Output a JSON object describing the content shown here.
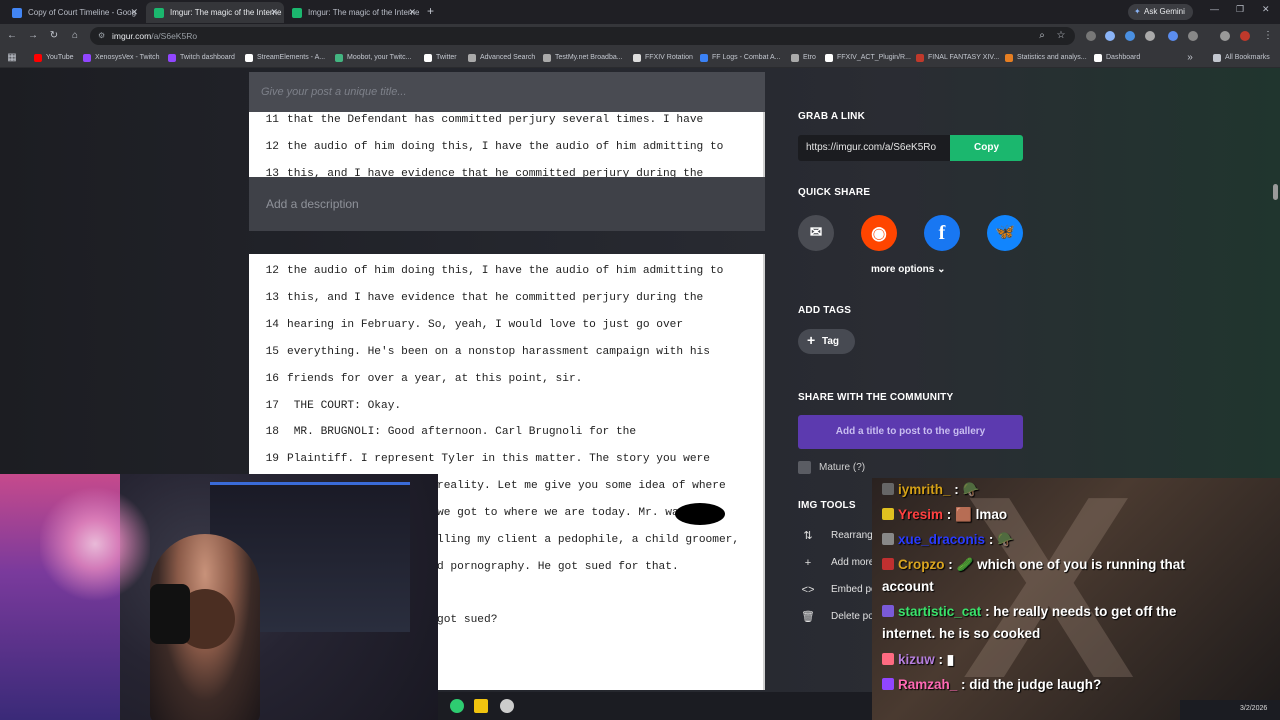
{
  "browser": {
    "tabs": [
      {
        "label": "Copy of Court Timeline - Goog",
        "color": "#4285f4"
      },
      {
        "label": "Imgur: The magic of the Interne",
        "color": "#1bb76e"
      },
      {
        "label": "Imgur: The magic of the Interne",
        "color": "#1bb76e"
      }
    ],
    "tab_close": "✕",
    "new_tab": "+",
    "gemini_label": "Ask Gemini",
    "url_host": "imgur.com",
    "url_path": "/a/S6eK5Ro",
    "bookmarks": [
      {
        "label": "YouTube",
        "color": "#ff0000"
      },
      {
        "label": "XenosysVex - Twitch",
        "color": "#9146ff"
      },
      {
        "label": "Twitch dashboard",
        "color": "#9146ff"
      },
      {
        "label": "StreamElements - A...",
        "color": "#ffffff"
      },
      {
        "label": "Moobot, your Twitc...",
        "color": "#43b581"
      },
      {
        "label": "Twitter",
        "color": "#ffffff"
      },
      {
        "label": "Advanced Search",
        "color": "#aaaaaa"
      },
      {
        "label": "TestMy.net Broadba...",
        "color": "#aaaaaa"
      },
      {
        "label": "FFXIV Rotation",
        "color": "#dddddd"
      },
      {
        "label": "FF Logs - Combat A...",
        "color": "#3b82f6"
      },
      {
        "label": "Etro",
        "color": "#aaaaaa"
      },
      {
        "label": "FFXIV_ACT_Plugin/R...",
        "color": "#ffffff"
      },
      {
        "label": "FINAL FANTASY XIV...",
        "color": "#c0392b"
      },
      {
        "label": "Statistics and analys...",
        "color": "#e67e22"
      },
      {
        "label": "Dashboard",
        "color": "#ffffff"
      }
    ],
    "all_bookmarks": "All Bookmarks"
  },
  "post": {
    "title_placeholder": "Give your post a unique title...",
    "description_placeholder": "Add a description",
    "doc1_lines": [
      {
        "n": "11",
        "t": "that the Defendant has committed perjury several times.  I have"
      },
      {
        "n": "12",
        "t": "the audio of him doing this, I have the audio of him admitting to"
      },
      {
        "n": "13",
        "t": "this, and I have evidence that he committed perjury during the"
      }
    ],
    "doc2_lines": [
      {
        "n": "12",
        "t": "the audio of him doing this, I have the audio of him admitting to"
      },
      {
        "n": "13",
        "t": "this, and I have evidence that he committed perjury during the"
      },
      {
        "n": "14",
        "t": "hearing in February.  So, yeah, I would love to just go over"
      },
      {
        "n": "15",
        "t": "everything.  He's been on a nonstop harassment campaign with his"
      },
      {
        "n": "16",
        "t": "friends for over a year, at this point, sir."
      },
      {
        "n": "17",
        "t": "     THE COURT:  Okay."
      },
      {
        "n": "18",
        "t": "     MR. BRUGNOLI:  Good afternoon.  Carl Brugnoli for the"
      },
      {
        "n": "19",
        "t": "Plaintiff.  I represent Tyler in this matter.  The story you were"
      },
      {
        "n": "",
        "t": "reality.  Let me give you some idea of where"
      },
      {
        "n": "",
        "t": "we got to where we are today.  Mr.        was"
      },
      {
        "n": "",
        "t": "lling my client a pedophile, a child groomer,"
      },
      {
        "n": "",
        "t": "d pornography.  He got sued for that."
      },
      {
        "n": "",
        "t": ""
      },
      {
        "n": "",
        "t": "got sued?"
      }
    ]
  },
  "sidebar": {
    "grab_link_heading": "GRAB A LINK",
    "link_value": "https://imgur.com/a/S6eK5Ro",
    "copy_label": "Copy",
    "quick_share_heading": "QUICK SHARE",
    "share_buttons": [
      {
        "name": "email",
        "glyph": "✉",
        "color": "#4a4c53"
      },
      {
        "name": "reddit",
        "glyph": "◉",
        "color": "#ff4500"
      },
      {
        "name": "facebook",
        "glyph": "f",
        "color": "#1877f2"
      },
      {
        "name": "bluesky",
        "glyph": "🦋",
        "color": "#1185fe"
      }
    ],
    "more_options": "more options",
    "add_tags_heading": "ADD TAGS",
    "tag_label": "Tag",
    "community_heading": "SHARE WITH THE COMMUNITY",
    "post_button": "Add a title to post to the gallery",
    "mature_label": "Mature (?)",
    "img_tools_heading": "IMG TOOLS",
    "tools": [
      {
        "icon": "⇅",
        "label": "Rearrange"
      },
      {
        "icon": "+",
        "label": "Add more"
      },
      {
        "icon": "<>",
        "label": "Embed post"
      },
      {
        "icon": "🗑",
        "label": "Delete post"
      }
    ]
  },
  "chat": {
    "messages": [
      {
        "user": "iymrith_",
        "color": "#d4a017",
        "text": ": 🪖"
      },
      {
        "user": "Yresim",
        "color": "#ff4040",
        "text": ": 🟫 lmao"
      },
      {
        "user": "xue_draconis",
        "color": "#2a3bff",
        "text": ": 🪖"
      },
      {
        "user": "Cropzo",
        "color": "#daa520",
        "text": ": 🥒 which one of you is running that account"
      },
      {
        "user": "startistic_cat",
        "color": "#3ae36b",
        "text": ": he really needs to get off the internet. he is so cooked"
      },
      {
        "user": "kizuw",
        "color": "#b57edc",
        "text": ": ▮"
      },
      {
        "user": "Ramzah_",
        "color": "#ff69b4",
        "text": ": did the judge laugh?"
      }
    ]
  },
  "taskbar": {
    "date": "3/2/2026"
  }
}
